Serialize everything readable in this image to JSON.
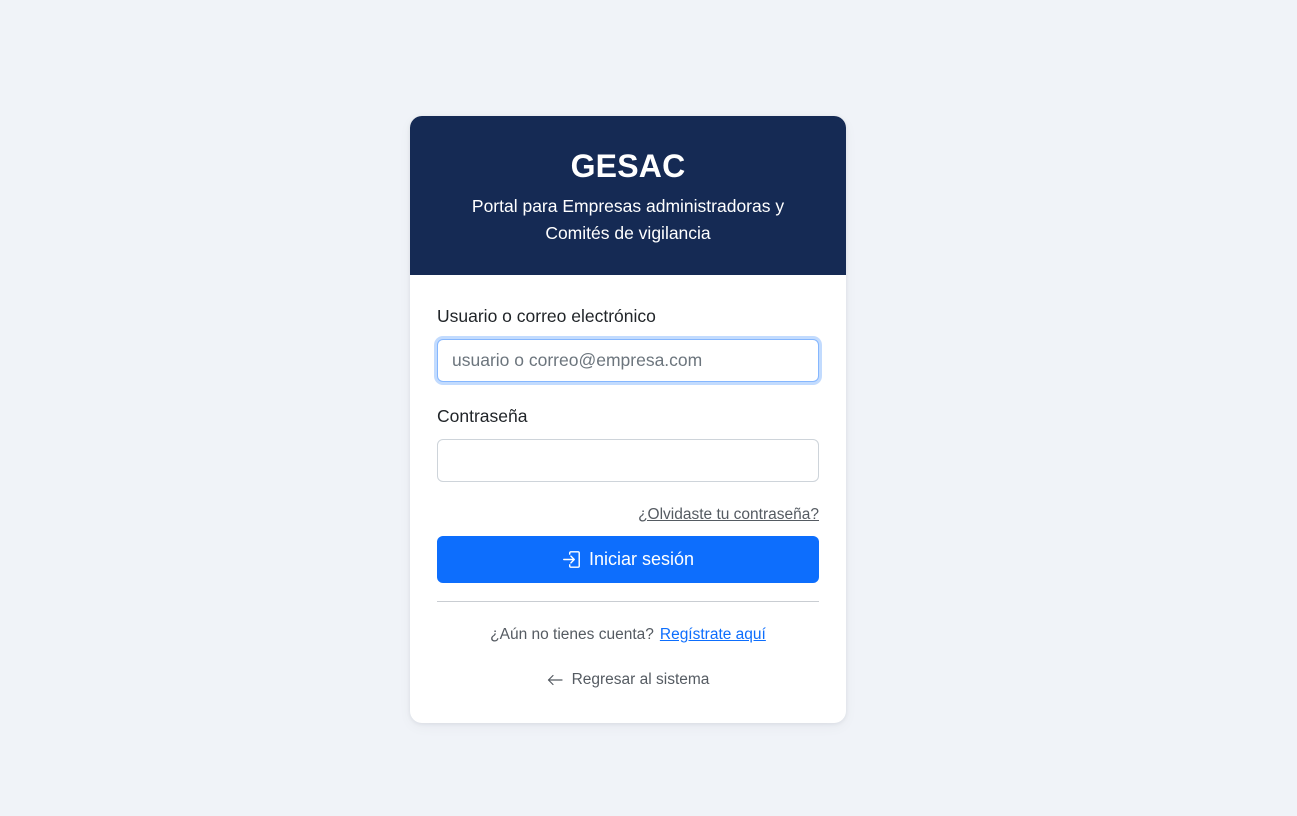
{
  "header": {
    "title": "GESAC",
    "subtitle": "Portal para Empresas administradoras y Comités de vigilancia"
  },
  "form": {
    "user_label": "Usuario o correo electrónico",
    "user_placeholder": "usuario o correo@empresa.com",
    "user_value": "",
    "password_label": "Contraseña",
    "password_value": "",
    "forgot_link": "¿Olvidaste tu contraseña?",
    "login_button": "Iniciar sesión",
    "login_icon": "box-arrow-in-right-icon"
  },
  "footer": {
    "register_prompt": "¿Aún no tienes cuenta?",
    "register_link": "Regístrate aquí",
    "back_link": "Regresar al sistema",
    "back_icon": "arrow-left-icon"
  },
  "colors": {
    "page_background": "#f0f3f8",
    "header_background": "#152a54",
    "primary": "#0d6efd",
    "focus_ring": "#86b7fe",
    "muted_text": "#555b62"
  }
}
